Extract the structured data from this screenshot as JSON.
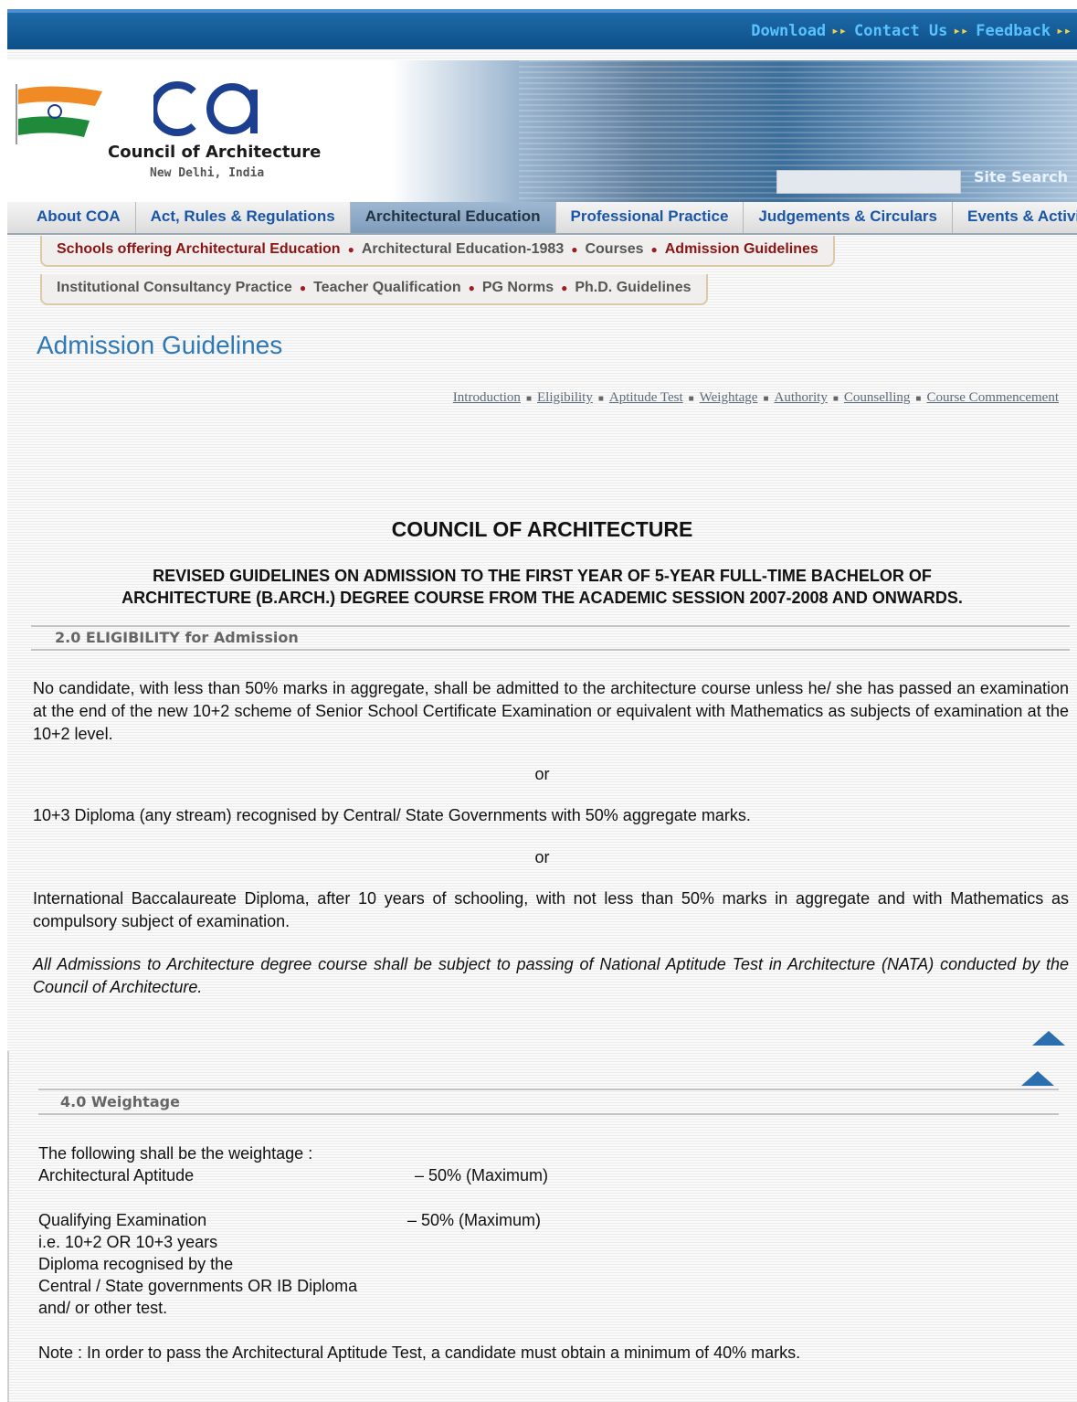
{
  "topbar": {
    "links": [
      "Download",
      "Contact Us",
      "Feedback"
    ]
  },
  "header": {
    "org_name": "Council of Architecture",
    "org_city": "New Delhi, India",
    "search_placeholder": "",
    "search_button": "Site Search"
  },
  "main_nav": {
    "tabs": [
      "About COA",
      "Act, Rules & Regulations",
      "Architectural Education",
      "Professional Practice",
      "Judgements & Circulars",
      "Events & Activities"
    ],
    "active": "Architectural Education"
  },
  "sub_nav": {
    "row1": [
      "Schools offering Architectural Education",
      "Architectural Education-1983",
      "Courses",
      "Admission Guidelines"
    ],
    "row2": [
      "Institutional Consultancy Practice",
      "Teacher Qualification",
      "PG Norms",
      "Ph.D. Guidelines"
    ]
  },
  "page": {
    "title": "Admission Guidelines",
    "section_links": [
      "Introduction",
      "Eligibility",
      "Aptitude Test",
      "Weightage",
      "Authority",
      "Counselling",
      "Course Commencement"
    ]
  },
  "document": {
    "org": "COUNCIL OF ARCHITECTURE",
    "subtitle_line1": "REVISED GUIDELINES ON ADMISSION TO THE FIRST YEAR OF 5-YEAR FULL-TIME BACHELOR OF",
    "subtitle_line2": "ARCHITECTURE (B.ARCH.) DEGREE COURSE FROM THE ACADEMIC SESSION 2007-2008 AND ONWARDS."
  },
  "eligibility": {
    "heading": "2.0 ELIGIBILITY for Admission",
    "para1": "No candidate, with less than 50% marks in aggregate, shall be admitted to the architecture course unless he/ she has passed an examination at the end of the new 10+2 scheme of Senior School Certificate Examination or equivalent with Mathematics as subjects of examination at the 10+2 level.",
    "or1": "or",
    "para2": "10+3 Diploma (any stream) recognised by Central/ State Governments with 50% aggregate marks.",
    "or2": "or",
    "para3": "International Baccalaureate Diploma, after 10 years of schooling, with not less than 50% marks in aggregate and with Mathematics as compulsory subject of examination.",
    "note": "All Admissions to Architecture degree course shall be subject to passing of National Aptitude Test in Architecture (NATA) conducted by the Council of Architecture."
  },
  "weightage": {
    "heading": "4.0 Weightage",
    "intro": "The following shall be the weightage :",
    "rows": [
      {
        "label": "Architectural Aptitude",
        "value": "– 50% (Maximum)"
      },
      {
        "label": "Qualifying Examination",
        "value": "– 50% (Maximum)"
      }
    ],
    "qualifying_detail": [
      "i.e. 10+2 OR 10+3 years",
      "Diploma recognised by the",
      "Central / State governments OR IB Diploma",
      "and/ or other test."
    ],
    "note": "Note : In order to pass the Architectural Aptitude Test, a candidate must obtain a minimum of 40% marks."
  },
  "colors": {
    "topbar": "#0d4f88",
    "link_blue": "#1a56a8",
    "title_blue": "#2e79b5",
    "dark_red": "#8a1414"
  }
}
